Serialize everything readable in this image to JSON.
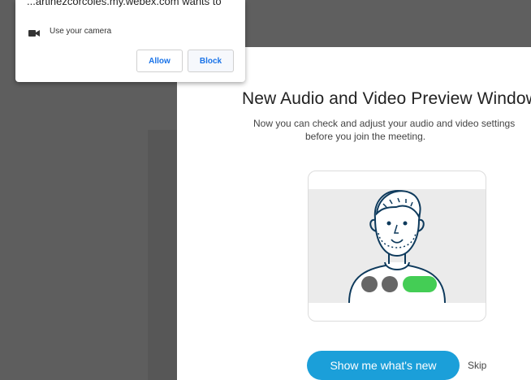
{
  "permission_popup": {
    "origin_text": "...artinezcorcoles.my.webex.com wants to",
    "camera_icon": "video-camera-icon",
    "permission_label": "Use your camera",
    "allow_label": "Allow",
    "block_label": "Block"
  },
  "dialog": {
    "title": "New Audio and Video Preview Window",
    "description_line1": "Now you can check and adjust your audio and video settings",
    "description_line2": "before you join the meeting.",
    "illustration_icon": "person-preview-illustration",
    "primary_button": "Show me what's new",
    "skip_label": "Skip"
  },
  "colors": {
    "accent": "#1b9fd9",
    "toggle_on": "#44cd55",
    "toggle_off": "#666666",
    "link": "#1a73e8"
  }
}
